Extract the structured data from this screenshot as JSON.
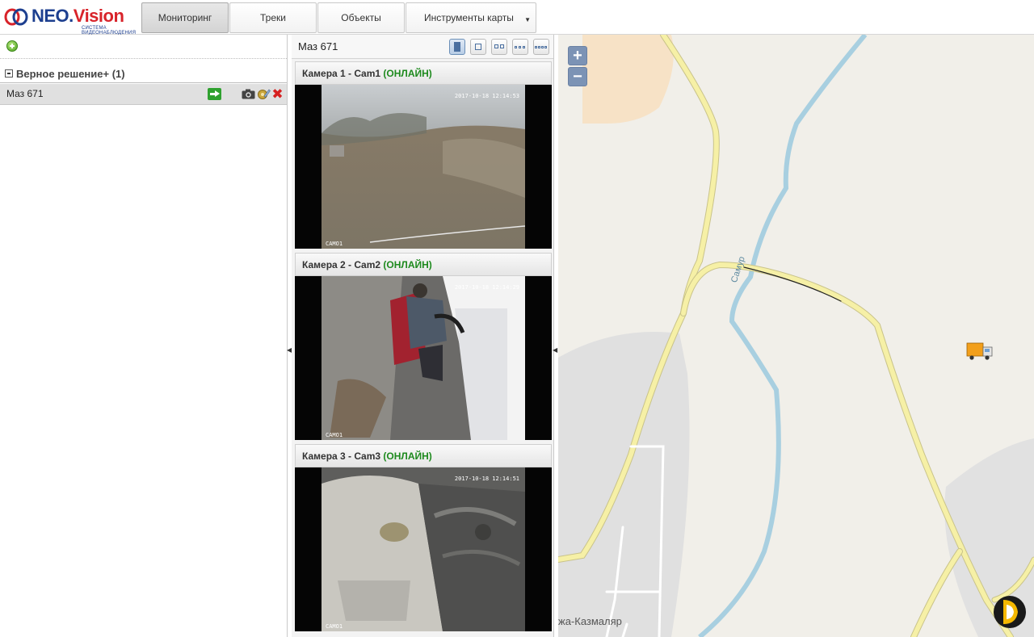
{
  "app": {
    "logo_part1": "NEO.",
    "logo_part2": "Vision",
    "logo_subtitle": "СИСТЕМА ВИДЕОНАБЛЮДЕНИЯ"
  },
  "tabs": [
    {
      "label": "Мониторинг",
      "active": true
    },
    {
      "label": "Треки",
      "active": false
    },
    {
      "label": "Объекты",
      "active": false
    },
    {
      "label": "Инструменты карты",
      "active": false,
      "dropdown": true
    }
  ],
  "sidebar": {
    "group_label": "Верное решение+ (1)",
    "vehicle_label": "Маз 671"
  },
  "video_panel": {
    "title": "Маз 671",
    "cameras": [
      {
        "title": "Камера 1 - Cam1",
        "status": "(ОНЛАЙН)",
        "overlay": "CAMO1",
        "timestamp": "2017-10-18 12:14:53"
      },
      {
        "title": "Камера 2 - Cam2",
        "status": "(ОНЛАЙН)",
        "overlay": "CAMO1",
        "timestamp": "2017-10-18 12:14:29"
      },
      {
        "title": "Камера 3 - Cam3",
        "status": "(ОНЛАЙН)",
        "overlay": "CAMO1",
        "timestamp": "2017-10-18 12:14:51"
      }
    ]
  },
  "map": {
    "zoom_in": "+",
    "zoom_out": "−",
    "river_label": "Самур",
    "place_label": "жа-Казмаляр"
  },
  "colors": {
    "accent": "#1d3f8f",
    "brand_red": "#d8232a",
    "online": "#1e8a1e",
    "road": "#f6f0a6",
    "river": "#a8cfe0"
  }
}
